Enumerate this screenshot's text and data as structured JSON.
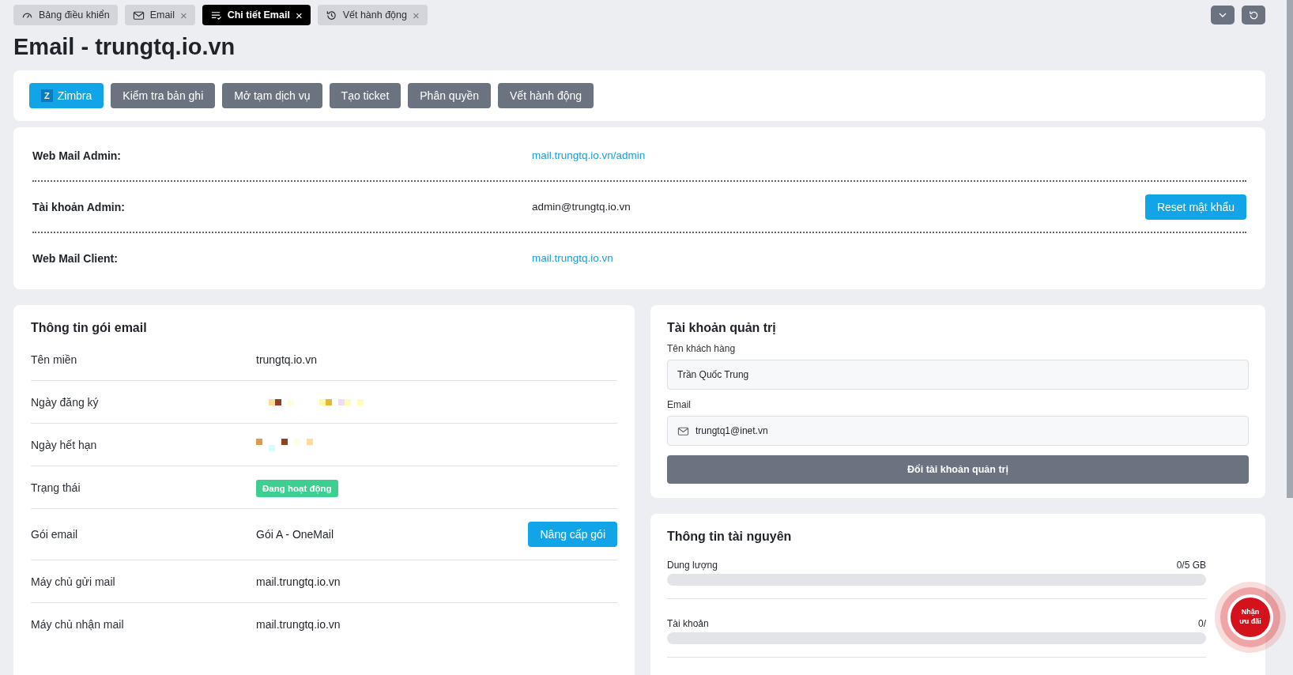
{
  "tabs": [
    {
      "label": "Bảng điều khiển",
      "closable": false,
      "selected": false
    },
    {
      "label": "Email",
      "closable": true,
      "selected": false
    },
    {
      "label": "Chi tiết Email",
      "closable": true,
      "selected": true
    },
    {
      "label": "Vết hành động",
      "closable": true,
      "selected": false
    }
  ],
  "tab_close": "×",
  "title": "Email - trungtq.io.vn",
  "toolbar": [
    {
      "label": "Zimbra",
      "badge": "Z",
      "kind": "primary"
    },
    {
      "label": "Kiểm tra bản ghi",
      "kind": "secondary"
    },
    {
      "label": "Mở tạm dịch vụ",
      "kind": "secondary"
    },
    {
      "label": "Tạo ticket",
      "kind": "secondary"
    },
    {
      "label": "Phân quyền",
      "kind": "secondary"
    },
    {
      "label": "Vết hành động",
      "kind": "secondary"
    }
  ],
  "access": [
    {
      "label": "Web Mail Admin:",
      "value": "mail.trungtq.io.vn/admin",
      "kind": "link"
    },
    {
      "label": "Tài khoản Admin:",
      "value": "admin@trungtq.io.vn",
      "kind": "text",
      "action": "Reset mật khẩu"
    },
    {
      "label": "Web Mail Client:",
      "value": "mail.trungtq.io.vn",
      "kind": "link"
    }
  ],
  "package": {
    "title": "Thông tin gói email",
    "rows": [
      {
        "label": "Tên miền",
        "kind": "text",
        "value": "trungtq.io.vn"
      },
      {
        "label": "Ngày đăng ký",
        "kind": "redacted"
      },
      {
        "label": "Ngày hết hạn",
        "kind": "redacted"
      },
      {
        "label": "Trạng thái",
        "kind": "status",
        "value": "Đang hoạt động"
      },
      {
        "label": "Gói email",
        "kind": "text",
        "value": "Gói A - OneMail",
        "action": "Nâng cấp gói"
      },
      {
        "label": "Máy chủ gửi mail",
        "kind": "text",
        "value": "mail.trungtq.io.vn"
      },
      {
        "label": "Máy chủ nhận mail",
        "kind": "text",
        "value": "mail.trungtq.io.vn"
      }
    ]
  },
  "admin_account": {
    "title": "Tài khoản quản trị",
    "fields": [
      {
        "label": "Tên khách hàng",
        "value": "Trần Quốc Trung",
        "kind": "text"
      },
      {
        "label": "Email",
        "value": "trungtq1@inet.vn",
        "kind": "email"
      }
    ],
    "button": "Đổi tài khoản quản trị"
  },
  "resources": {
    "title": "Thông tin tài nguyên",
    "items": [
      {
        "label": "Dung lượng",
        "reading": "0/5 GB",
        "level": 0
      },
      {
        "label": "Tài khoản",
        "reading": "0/",
        "level": 0
      }
    ]
  },
  "promo_badge": "Nhận ưu đãi"
}
